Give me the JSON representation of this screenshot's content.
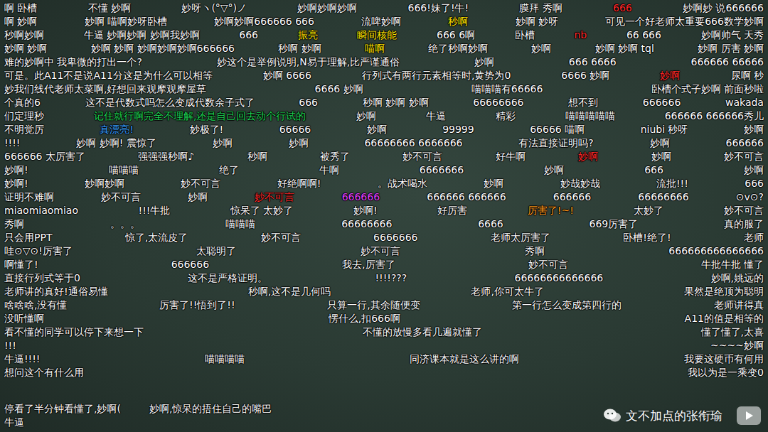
{
  "video": {
    "danmaku_lanes": [
      {
        "comments": [
          {
            "text": "啊 卧槽",
            "color": "#ffffff"
          },
          {
            "text": "不懂 妙啊",
            "color": "#ffffff"
          },
          {
            "text": "妙呀ヽ(°▽°)ノ",
            "color": "#ffffff"
          },
          {
            "text": "妙啊妙啊妙啊",
            "color": "#ffffff"
          },
          {
            "text": "666!妹了!牛!",
            "color": "#ffffff"
          },
          {
            "text": "膜拜 秀啊",
            "color": "#ffffff"
          },
          {
            "text": "666",
            "color": "#ff2a2a"
          },
          {
            "text": "妙啊妙 说666666",
            "color": "#ffffff"
          }
        ]
      },
      {
        "comments": [
          {
            "text": "啊 妙啊",
            "color": "#ffffff"
          },
          {
            "text": "妙啊 喵啊妙呀卧槽",
            "color": "#ffffff"
          },
          {
            "text": "妙啊妙啊666666 666",
            "color": "#ffffff"
          },
          {
            "text": "流啤妙啊",
            "color": "#ffffff"
          },
          {
            "text": "秒啊",
            "color": "#ffe600"
          },
          {
            "text": "妙啊 妙呀",
            "color": "#ffffff"
          },
          {
            "text": "可见一个好老师太重要666数学妙啊",
            "color": "#ffffff"
          }
        ]
      },
      {
        "comments": [
          {
            "text": "秒啊妙啊",
            "color": "#ffffff"
          },
          {
            "text": "牛逼 妙啊妙啊 妙啊我妙啊",
            "color": "#ffffff"
          },
          {
            "text": "666",
            "color": "#ffffff"
          },
          {
            "text": "振亮",
            "color": "#ffe600"
          },
          {
            "text": "瞬间核能",
            "color": "#ffe600"
          },
          {
            "text": "666 6啊",
            "color": "#ffffff"
          },
          {
            "text": "卧槽",
            "color": "#ffffff"
          },
          {
            "text": "nb",
            "color": "#ff2a2a"
          },
          {
            "text": "66 666",
            "color": "#ffffff"
          },
          {
            "text": "妙啊帅气 天秀",
            "color": "#ffffff"
          }
        ]
      },
      {
        "comments": [
          {
            "text": "妙啊 妙啊",
            "color": "#ffffff"
          },
          {
            "text": "妙啊 妙啊 妙啊妙啊妙啊666666",
            "color": "#ffffff"
          },
          {
            "text": "秒啊 妙啊",
            "color": "#ffffff"
          },
          {
            "text": "喵啊",
            "color": "#ffe600"
          },
          {
            "text": "绝了秒啊妙啊",
            "color": "#ffffff"
          },
          {
            "text": "妙啊",
            "color": "#ffffff"
          },
          {
            "text": "妙啊 妙啊 tql",
            "color": "#ffffff"
          },
          {
            "text": "妙啊 厉害 妙啊",
            "color": "#ffffff"
          }
        ]
      },
      {
        "comments": [
          {
            "text": "难的妙啊中 我卑微的打出一个?",
            "color": "#ffffff"
          },
          {
            "text": "妙这个是举例说明,N易于理解,比严谨通俗",
            "color": "#ffffff"
          },
          {
            "text": "妙啊",
            "color": "#ffffff"
          },
          {
            "text": "666 6666",
            "color": "#ffffff"
          },
          {
            "text": "666666 66666",
            "color": "#ffffff"
          }
        ]
      },
      {
        "comments": [
          {
            "text": "可是。此A11不是说A11分这是为什么可以相等",
            "color": "#ffffff"
          },
          {
            "text": "妙啊 6666",
            "color": "#ffffff"
          },
          {
            "text": "行列式有两行元素相等时,黄势为0",
            "color": "#ffffff"
          },
          {
            "text": "6666 妙啊",
            "color": "#ffffff"
          },
          {
            "text": "妙啊",
            "color": "#ff2a2a"
          },
          {
            "text": "尿啊 秒",
            "color": "#ffffff"
          }
        ]
      },
      {
        "comments": [
          {
            "text": "妙我们线代老师太菜啊,好想回来观摩观摩屋草",
            "color": "#ffffff"
          },
          {
            "text": "6666 妙啊",
            "color": "#ffffff"
          },
          {
            "text": "喵喵喵有66666",
            "color": "#ffffff"
          },
          {
            "text": "卧槽个式子妙啊 前面秒啦",
            "color": "#ffffff"
          }
        ]
      },
      {
        "comments": [
          {
            "text": "个真的6",
            "color": "#ffffff"
          },
          {
            "text": "这不是代数式吗怎么变成代数余子式了",
            "color": "#ffffff"
          },
          {
            "text": "666",
            "color": "#ffffff"
          },
          {
            "text": "秒啊 妙啊 妙啊",
            "color": "#ffffff"
          },
          {
            "text": "66666666",
            "color": "#ffffff"
          },
          {
            "text": "想不到",
            "color": "#ffffff"
          },
          {
            "text": "666666",
            "color": "#ffffff"
          },
          {
            "text": "wakada",
            "color": "#ffffff"
          }
        ]
      },
      {
        "comments": [
          {
            "text": "们定理秒",
            "color": "#ffffff"
          },
          {
            "text": "记住就行啊完全不理解,还是自己回去动个行试的",
            "color": "#1fd655"
          },
          {
            "text": "妙啊",
            "color": "#ffffff"
          },
          {
            "text": "牛逼",
            "color": "#ffffff"
          },
          {
            "text": "精彩",
            "color": "#ffffff"
          },
          {
            "text": "喵喵喵喵喵",
            "color": "#ffffff"
          },
          {
            "text": "666666 666666秀儿",
            "color": "#ffffff"
          }
        ]
      },
      {
        "comments": [
          {
            "text": "不明觉厉",
            "color": "#ffffff"
          },
          {
            "text": "真漂亮!",
            "color": "#3aa0ff"
          },
          {
            "text": "妙极了!",
            "color": "#ffffff"
          },
          {
            "text": "66666",
            "color": "#ffffff"
          },
          {
            "text": "妙啊",
            "color": "#ffffff"
          },
          {
            "text": "99999",
            "color": "#ffffff"
          },
          {
            "text": "66666 喵啊",
            "color": "#ffffff"
          },
          {
            "text": "niubi 秒呀",
            "color": "#ffffff"
          },
          {
            "text": "妙啊",
            "color": "#ffffff"
          }
        ]
      },
      {
        "comments": [
          {
            "text": "!!!!",
            "color": "#ffffff"
          },
          {
            "text": "妙啊 妙啊! 震惊了",
            "color": "#ffffff"
          },
          {
            "text": "妙啊",
            "color": "#ffffff"
          },
          {
            "text": "妙啊",
            "color": "#ffffff"
          },
          {
            "text": "66666666 6666666",
            "color": "#ffffff"
          },
          {
            "text": "有法直接证明吗?",
            "color": "#ffffff"
          },
          {
            "text": "妙啊",
            "color": "#ffffff"
          },
          {
            "text": "666666",
            "color": "#ffffff"
          }
        ]
      },
      {
        "comments": [
          {
            "text": "666666 太厉害了",
            "color": "#ffffff"
          },
          {
            "text": "强强强秒啊♪",
            "color": "#ffffff"
          },
          {
            "text": "秒啊",
            "color": "#ffffff"
          },
          {
            "text": "被秀了",
            "color": "#ffffff"
          },
          {
            "text": "妙不可言",
            "color": "#ffffff"
          },
          {
            "text": "好牛啊",
            "color": "#ffffff"
          },
          {
            "text": "妙啊",
            "color": "#ff2a2a"
          },
          {
            "text": "妙啊",
            "color": "#ffffff"
          },
          {
            "text": "妙不可言",
            "color": "#ffffff"
          }
        ]
      },
      {
        "comments": [
          {
            "text": "妙啊!",
            "color": "#ffffff"
          },
          {
            "text": "喵喵喵",
            "color": "#ffffff"
          },
          {
            "text": "绝了",
            "color": "#ffffff"
          },
          {
            "text": "牛啊",
            "color": "#ffffff"
          },
          {
            "text": "6666666",
            "color": "#ffffff"
          },
          {
            "text": "妙啊",
            "color": "#ffffff"
          },
          {
            "text": "666",
            "color": "#ffffff"
          },
          {
            "text": "妙啊",
            "color": "#ffffff"
          }
        ]
      },
      {
        "comments": [
          {
            "text": "妙啊!",
            "color": "#ffffff"
          },
          {
            "text": "妙啊妙啊",
            "color": "#ffffff"
          },
          {
            "text": "妙不可言",
            "color": "#ffffff"
          },
          {
            "text": "好绝啊啊!",
            "color": "#ffffff"
          },
          {
            "text": "。战术喝水",
            "color": "#ffffff"
          },
          {
            "text": "妙啊",
            "color": "#ffffff"
          },
          {
            "text": "妙哉妙哉",
            "color": "#ffffff"
          },
          {
            "text": "流批!!!",
            "color": "#ffffff"
          },
          {
            "text": "666",
            "color": "#ffffff"
          }
        ]
      },
      {
        "comments": [
          {
            "text": "证明不难啊",
            "color": "#ffffff"
          },
          {
            "text": "妙不可言",
            "color": "#ffffff"
          },
          {
            "text": "妙啊",
            "color": "#ffffff"
          },
          {
            "text": "妙不可言",
            "color": "#ff2a2a"
          },
          {
            "text": "666666",
            "color": "#e040fb"
          },
          {
            "text": "666666 666666",
            "color": "#ffffff"
          },
          {
            "text": "666666",
            "color": "#ffffff"
          },
          {
            "text": "66666666",
            "color": "#ffffff"
          },
          {
            "text": "⊙v⊙?",
            "color": "#ffffff"
          }
        ]
      },
      {
        "comments": [
          {
            "text": "miaomiaomiao",
            "color": "#ffffff"
          },
          {
            "text": "!!!牛批",
            "color": "#ffffff"
          },
          {
            "text": "惊呆了 太妙了",
            "color": "#ffffff"
          },
          {
            "text": "妙啊!",
            "color": "#ffffff"
          },
          {
            "text": "好厉害",
            "color": "#ffffff"
          },
          {
            "text": "厉害了!~!",
            "color": "#ff9a1a"
          },
          {
            "text": "太妙了",
            "color": "#ffffff"
          },
          {
            "text": "妙不可言",
            "color": "#ffffff"
          }
        ]
      },
      {
        "comments": [
          {
            "text": "秀啊",
            "color": "#ffffff"
          },
          {
            "text": "。。。",
            "color": "#ffffff"
          },
          {
            "text": "喵喵喵",
            "color": "#ffffff"
          },
          {
            "text": "66666666",
            "color": "#ffffff"
          },
          {
            "text": "6666",
            "color": "#ffffff"
          },
          {
            "text": "669厉害了",
            "color": "#ffffff"
          },
          {
            "text": "真的服了",
            "color": "#ffffff"
          }
        ]
      },
      {
        "comments": [
          {
            "text": "只会用PPT",
            "color": "#ffffff"
          },
          {
            "text": "惊了,太流皮了",
            "color": "#ffffff"
          },
          {
            "text": "妙不可言",
            "color": "#ffffff"
          },
          {
            "text": "6666666",
            "color": "#ffffff"
          },
          {
            "text": "老师太厉害了",
            "color": "#ffffff"
          },
          {
            "text": "卧槽!绝了!",
            "color": "#ffffff"
          },
          {
            "text": "老师",
            "color": "#ffffff"
          }
        ]
      },
      {
        "comments": [
          {
            "text": "哇⊙▽⊙!厉害了",
            "color": "#ffffff"
          },
          {
            "text": "太聪明了",
            "color": "#ffffff"
          },
          {
            "text": "妙不可言",
            "color": "#ffffff"
          },
          {
            "text": "秀啊",
            "color": "#ffffff"
          },
          {
            "text": "666666666666666",
            "color": "#ffffff"
          }
        ]
      },
      {
        "comments": [
          {
            "text": "啊懂了!",
            "color": "#ffffff"
          },
          {
            "text": "666666",
            "color": "#ffffff"
          },
          {
            "text": "我去,厉害了",
            "color": "#ffffff"
          },
          {
            "text": "妙不可言",
            "color": "#ffffff"
          },
          {
            "text": "牛批牛批 懂了",
            "color": "#ffffff"
          }
        ]
      },
      {
        "comments": [
          {
            "text": "直接行列式等于0",
            "color": "#ffffff"
          },
          {
            "text": "这不是严格证明。",
            "color": "#ffffff"
          },
          {
            "text": "!!!!???",
            "color": "#ffffff"
          },
          {
            "text": "66666666666666",
            "color": "#ffffff"
          },
          {
            "text": "妙啊,姚远的",
            "color": "#ffffff"
          }
        ]
      },
      {
        "comments": [
          {
            "text": "老师讲的真好!通俗易懂",
            "color": "#ffffff"
          },
          {
            "text": "秒啊,这不是几何吗",
            "color": "#ffffff"
          },
          {
            "text": "老师,你可太牛了",
            "color": "#ffffff"
          },
          {
            "text": "果然是绝顶为聪明",
            "color": "#ffffff"
          }
        ]
      },
      {
        "comments": [
          {
            "text": "啥啥啥,没有懂",
            "color": "#ffffff"
          },
          {
            "text": "厉害了!!悟到了!!",
            "color": "#ffffff"
          },
          {
            "text": "只算一行,其余随便变",
            "color": "#ffffff"
          },
          {
            "text": "第一行怎么变成第四行的",
            "color": "#ffffff"
          },
          {
            "text": "老师讲得真",
            "color": "#ffffff"
          }
        ]
      },
      {
        "comments": [
          {
            "text": "没听懂啊",
            "color": "#ffffff"
          },
          {
            "text": "愣什么,扣666啊",
            "color": "#ffffff"
          },
          {
            "text": "A11的值是相等的",
            "color": "#ffffff"
          }
        ]
      },
      {
        "comments": [
          {
            "text": "看不懂的同学可以停下来想一下",
            "color": "#ffffff"
          },
          {
            "text": "不懂的放慢多看几遍就懂了",
            "color": "#ffffff"
          },
          {
            "text": "懂了懂了,太喜",
            "color": "#ffffff"
          }
        ]
      },
      {
        "comments": [
          {
            "text": "!!!",
            "color": "#ffffff"
          },
          {
            "text": "~~~~妙啊",
            "color": "#ffffff"
          }
        ]
      },
      {
        "comments": [
          {
            "text": "牛逼!!!!",
            "color": "#ffffff"
          },
          {
            "text": "喵喵喵喵",
            "color": "#ffffff"
          },
          {
            "text": "同济课本就是这么讲的啊",
            "color": "#ffffff"
          },
          {
            "text": "我要这硬币有何用",
            "color": "#ffffff"
          }
        ]
      },
      {
        "comments": [
          {
            "text": "想问这个有什么用",
            "color": "#ffffff"
          },
          {
            "text": "我以为是一乘变0",
            "color": "#ffffff"
          }
        ]
      },
      {
        "comments": [
          {
            "text": "停看了半分钟看懂了,妙啊(",
            "color": "#ffffff"
          },
          {
            "text": "妙啊,惊呆的捂住自己的嘴巴",
            "color": "#ffffff"
          }
        ]
      },
      {
        "comments": [
          {
            "text": "牛逼",
            "color": "#ffffff"
          }
        ]
      }
    ]
  },
  "watermark": {
    "text": "文不加点的张衔瑜"
  }
}
